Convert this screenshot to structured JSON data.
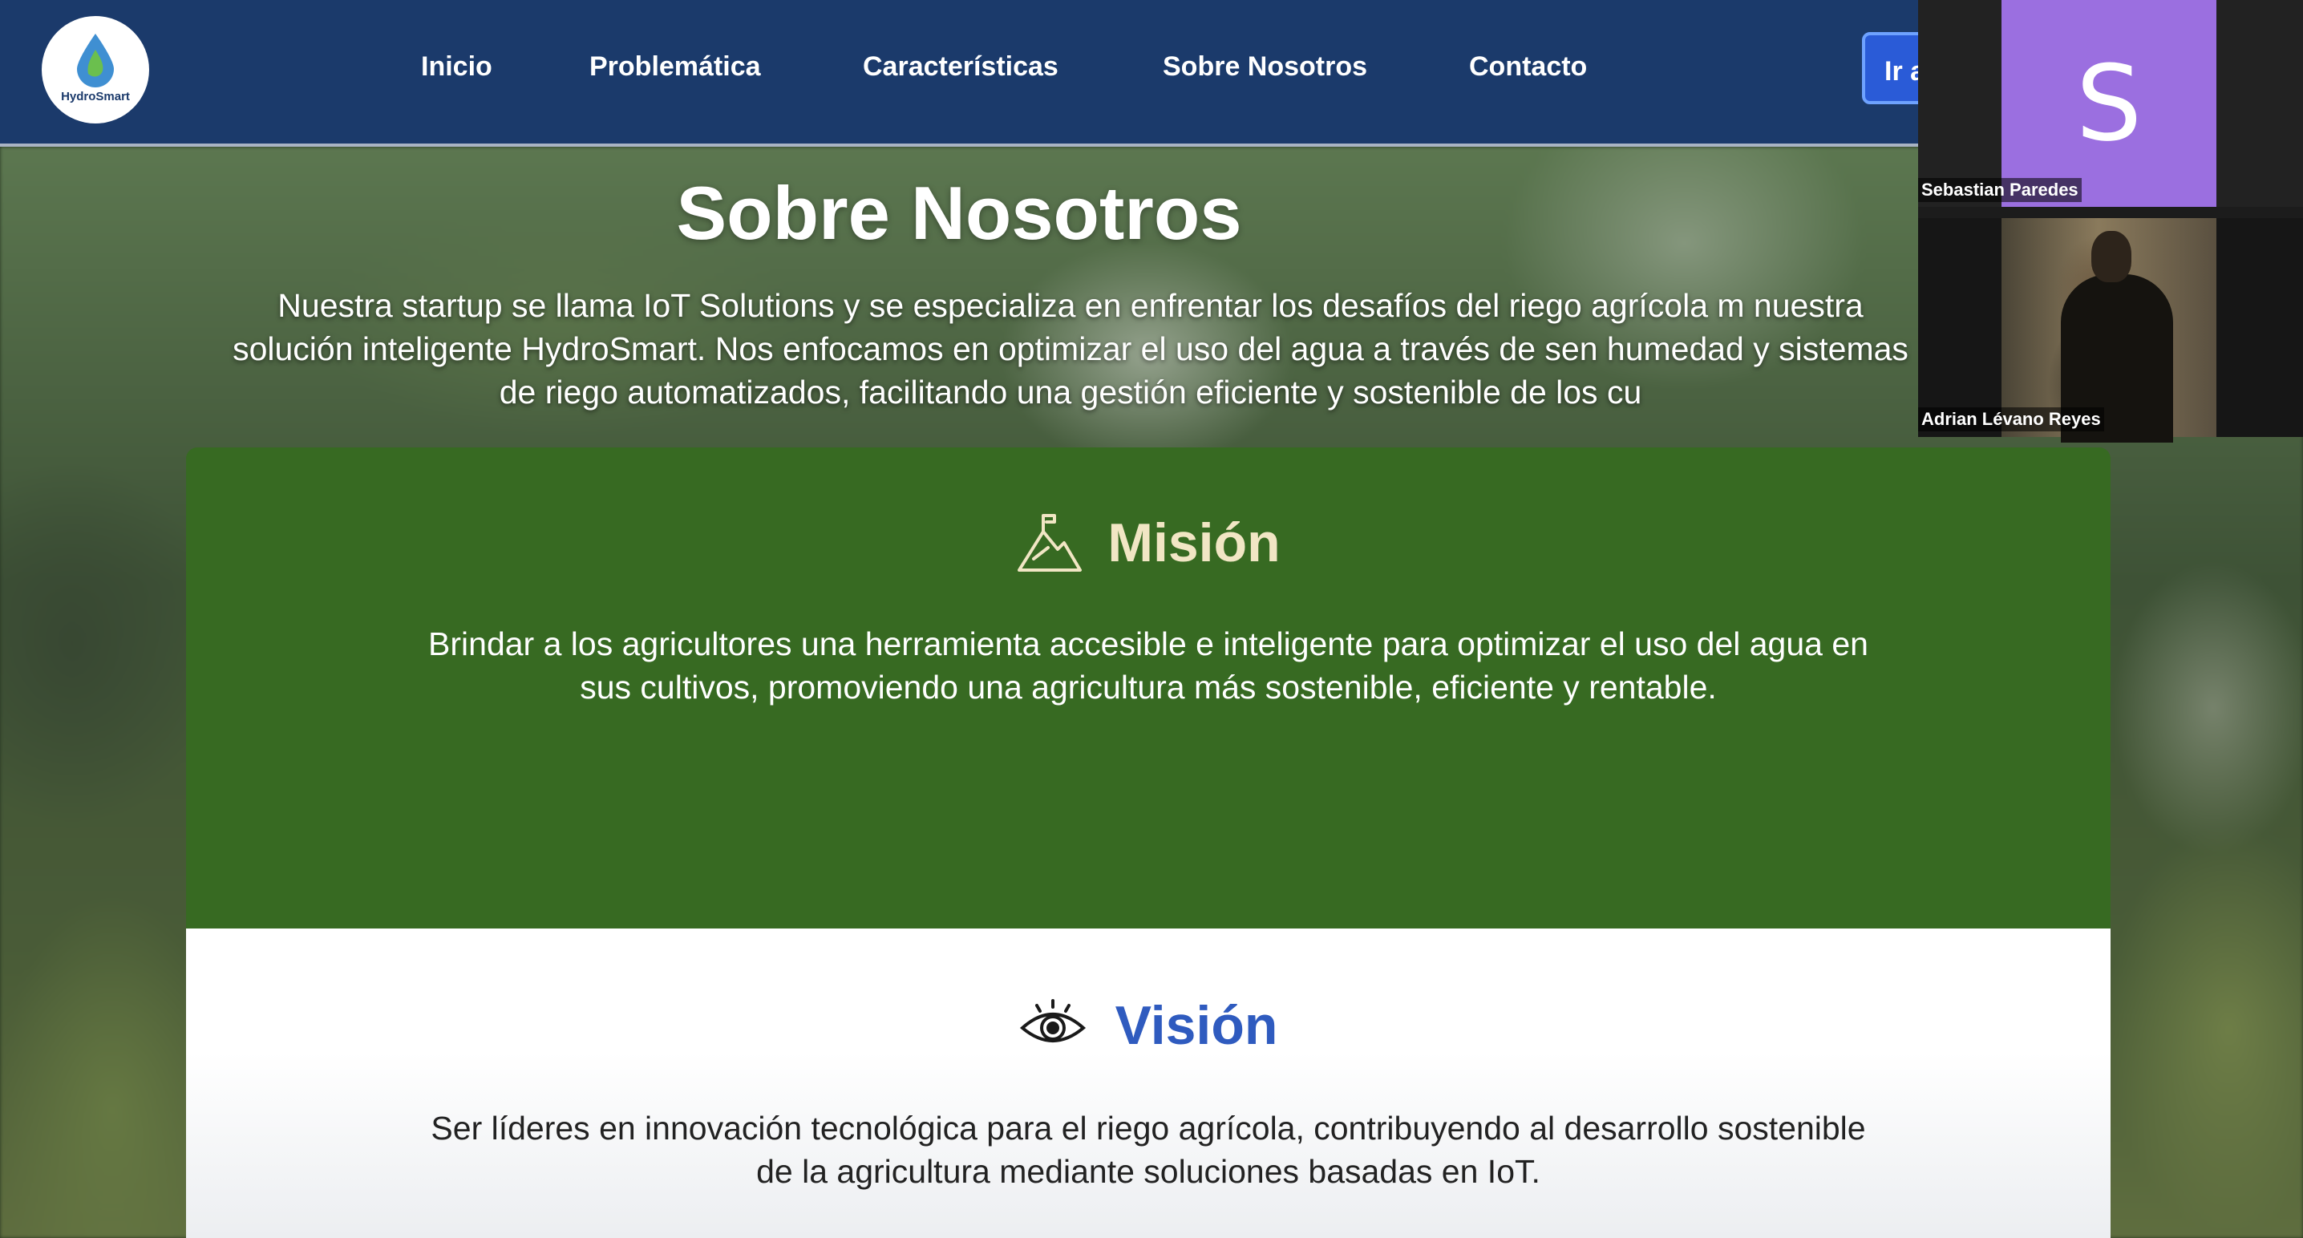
{
  "brand": {
    "logo_text": "HydroSmart",
    "colors": {
      "nav": "#1b3a6b",
      "mision_bg": "#376a22",
      "mision_title": "#f1e6c4",
      "vision_title": "#2f5bbf"
    }
  },
  "nav": {
    "links": [
      "Inicio",
      "Problemática",
      "Características",
      "Sobre Nosotros",
      "Contacto"
    ],
    "cta_label": "Ir a"
  },
  "hero": {
    "title": "Sobre Nosotros",
    "text": "Nuestra startup se llama IoT Solutions y se especializa en enfrentar los desafíos del riego agrícola m nuestra solución inteligente HydroSmart. Nos enfocamos en optimizar el uso del agua a través de sen humedad y sistemas de riego automatizados, facilitando una gestión eficiente y sostenible de los cu"
  },
  "mision": {
    "icon": "mountain-flag-icon",
    "title": "Misión",
    "text": "Brindar a los agricultores una herramienta accesible e inteligente para optimizar el uso del agua en sus cultivos, promoviendo una agricultura más sostenible, eficiente y rentable."
  },
  "vision": {
    "icon": "eye-icon",
    "title": "Visión",
    "text": "Ser líderes en innovación tecnológica para el riego agrícola, contribuyendo al desarrollo sostenible de la agricultura mediante soluciones basadas en IoT."
  },
  "call": {
    "participants": [
      {
        "name": "Sebastian Paredes",
        "initial": "S",
        "avatar_color": "#9b6fe0"
      },
      {
        "name": "Adrian Lévano Reyes"
      }
    ]
  }
}
